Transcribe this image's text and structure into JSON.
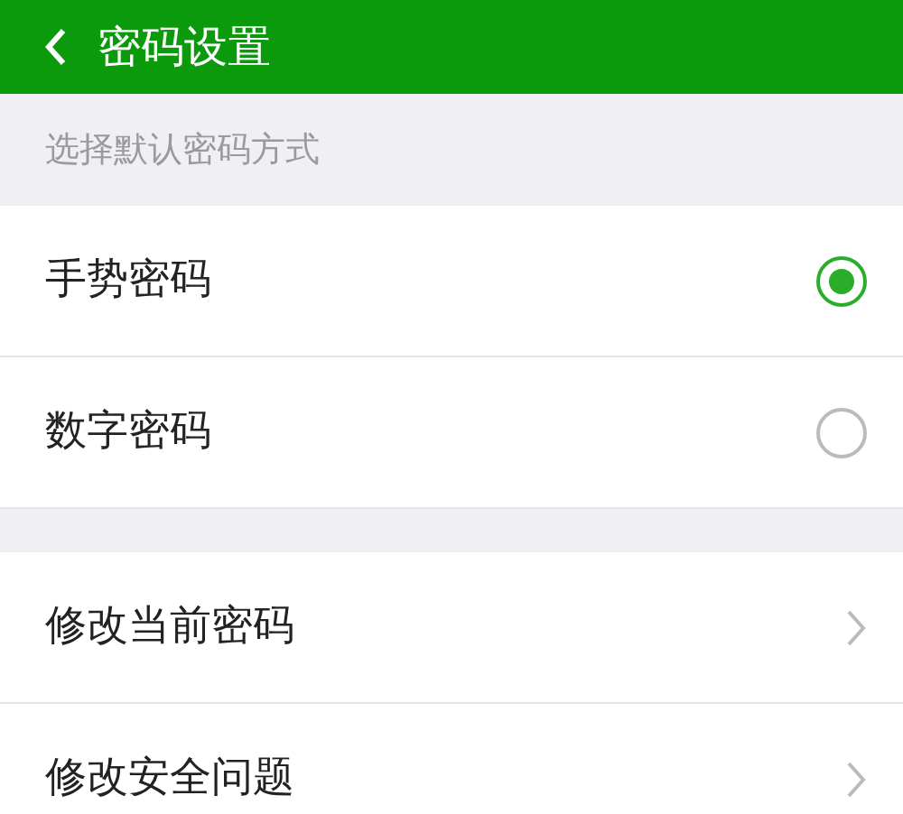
{
  "header": {
    "title": "密码设置"
  },
  "section_label": "选择默认密码方式",
  "options": [
    {
      "label": "手势密码",
      "selected": true
    },
    {
      "label": "数字密码",
      "selected": false
    }
  ],
  "menu": [
    {
      "label": "修改当前密码"
    },
    {
      "label": "修改安全问题"
    }
  ]
}
